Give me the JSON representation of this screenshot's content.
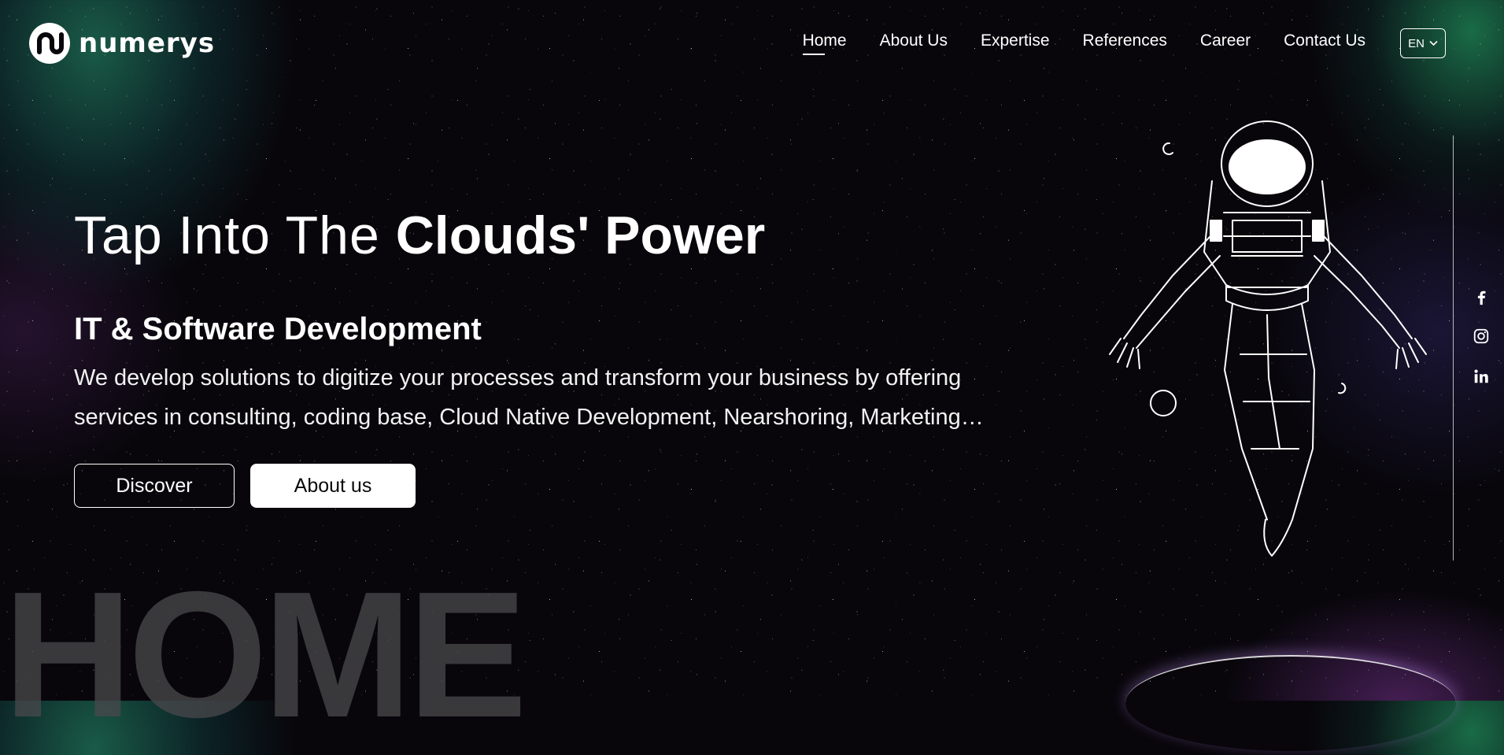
{
  "brand": {
    "name": "numerys"
  },
  "nav": {
    "items": [
      {
        "label": "Home",
        "active": true
      },
      {
        "label": "About Us",
        "active": false
      },
      {
        "label": "Expertise",
        "active": false
      },
      {
        "label": "References",
        "active": false
      },
      {
        "label": "Career",
        "active": false
      },
      {
        "label": "Contact Us",
        "active": false
      }
    ]
  },
  "language": {
    "selected": "EN"
  },
  "hero": {
    "headline_light": "Tap Into The ",
    "headline_bold": "Clouds' Power",
    "subtitle": "IT & Software Development",
    "description": "We develop solutions to digitize your processes and transform your business by offering services in consulting, coding base, Cloud Native Development, Nearshoring, Marketing…",
    "primary_button": "Discover",
    "secondary_button": "About us",
    "watermark": "HOME"
  },
  "social": {
    "icons": [
      "facebook-icon",
      "instagram-icon",
      "linkedin-icon"
    ]
  },
  "colors": {
    "background": "#08060b",
    "text": "#ffffff",
    "watermark": "#4a494c",
    "glow_green": "#28be78",
    "glow_purple": "#8c3caa"
  }
}
